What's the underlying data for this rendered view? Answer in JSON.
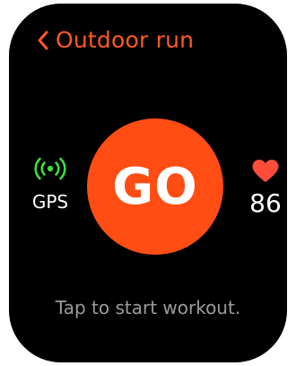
{
  "header": {
    "back_icon": "chevron-left-icon",
    "title": "Outdoor run"
  },
  "start_button": {
    "label": "GO"
  },
  "gps": {
    "icon": "gps-signal-icon",
    "label": "GPS",
    "status_color": "#3ddc3d"
  },
  "heart_rate": {
    "icon": "heart-icon",
    "value": "86",
    "icon_color": "#ff4d3a"
  },
  "hint": "Tap to start workout.",
  "colors": {
    "accent": "#ff5a1f",
    "go_button": "#ff4d14",
    "background": "#000000",
    "hint_text": "#9b9b9b"
  }
}
